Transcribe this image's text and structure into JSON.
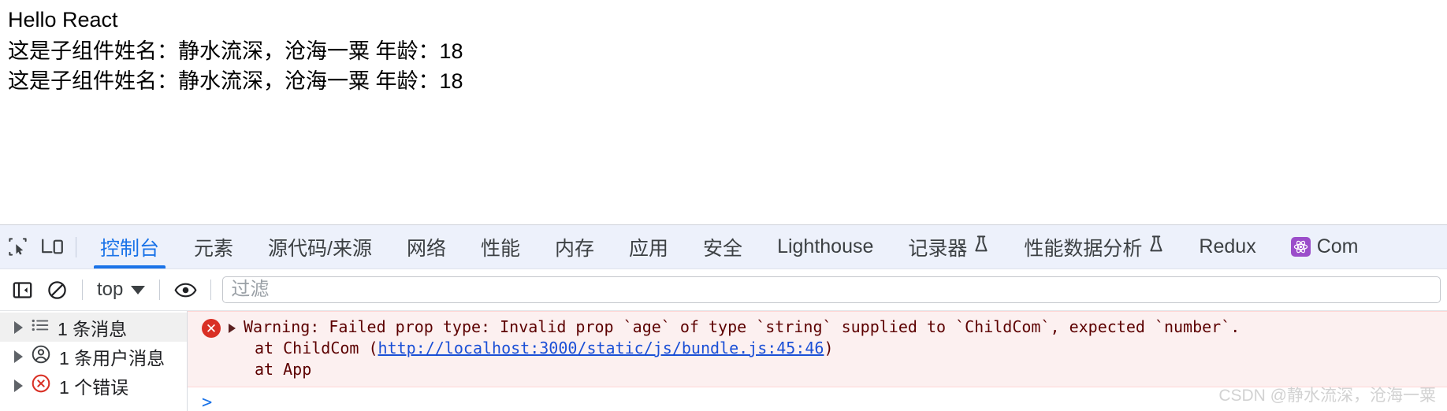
{
  "page": {
    "title": "Hello React",
    "lines": [
      "这是子组件姓名：静水流深，沧海一粟 年龄：18",
      "这是子组件姓名：静水流深，沧海一粟 年龄：18"
    ]
  },
  "devtools": {
    "left_icons": [
      {
        "name": "inspect-element-icon",
        "label": "检查元素"
      },
      {
        "name": "device-toolbar-icon",
        "label": "切换设备工具栏"
      }
    ],
    "tabs": [
      {
        "label": "控制台",
        "active": true,
        "icon": null
      },
      {
        "label": "元素",
        "active": false,
        "icon": null
      },
      {
        "label": "源代码/来源",
        "active": false,
        "icon": null
      },
      {
        "label": "网络",
        "active": false,
        "icon": null
      },
      {
        "label": "性能",
        "active": false,
        "icon": null
      },
      {
        "label": "内存",
        "active": false,
        "icon": null
      },
      {
        "label": "应用",
        "active": false,
        "icon": null
      },
      {
        "label": "安全",
        "active": false,
        "icon": null
      },
      {
        "label": "Lighthouse",
        "active": false,
        "icon": null
      },
      {
        "label": "记录器",
        "active": false,
        "icon": "flask-icon"
      },
      {
        "label": "性能数据分析",
        "active": false,
        "icon": "flask-icon"
      },
      {
        "label": "Redux",
        "active": false,
        "icon": null
      },
      {
        "label": "Com",
        "active": false,
        "icon": "react-components-icon"
      }
    ],
    "toolbar": {
      "sidebar_toggle_label": "显示控制台侧边栏",
      "clear_label": "清除控制台",
      "context_value": "top",
      "eye_label": "创建实时项目",
      "filter_placeholder": "过滤",
      "filter_value": ""
    },
    "sidebar": [
      {
        "label": "1 条消息",
        "icon": "list-icon",
        "selected": true
      },
      {
        "label": "1 条用户消息",
        "icon": "user-icon",
        "selected": false
      },
      {
        "label": "1 个错误",
        "icon": "error-circle-icon",
        "selected": false
      }
    ],
    "console": {
      "message": {
        "level": "error",
        "text": "Warning: Failed prop type: Invalid prop `age` of type `string` supplied to `ChildCom`, expected `number`.",
        "stack": [
          {
            "prefix": "    at ChildCom (",
            "link": "http://localhost:3000/static/js/bundle.js:45:46",
            "suffix": ")"
          },
          {
            "prefix": "    at App",
            "link": "",
            "suffix": ""
          }
        ]
      },
      "prompt": ">"
    }
  },
  "watermark": "CSDN @静水流深，沧海一粟",
  "colors": {
    "accent": "#1a73e8",
    "error": "#d93025",
    "tabstrip_bg": "#edf1fb",
    "error_bg": "#fcf0f0",
    "link": "#1a4fd6"
  }
}
